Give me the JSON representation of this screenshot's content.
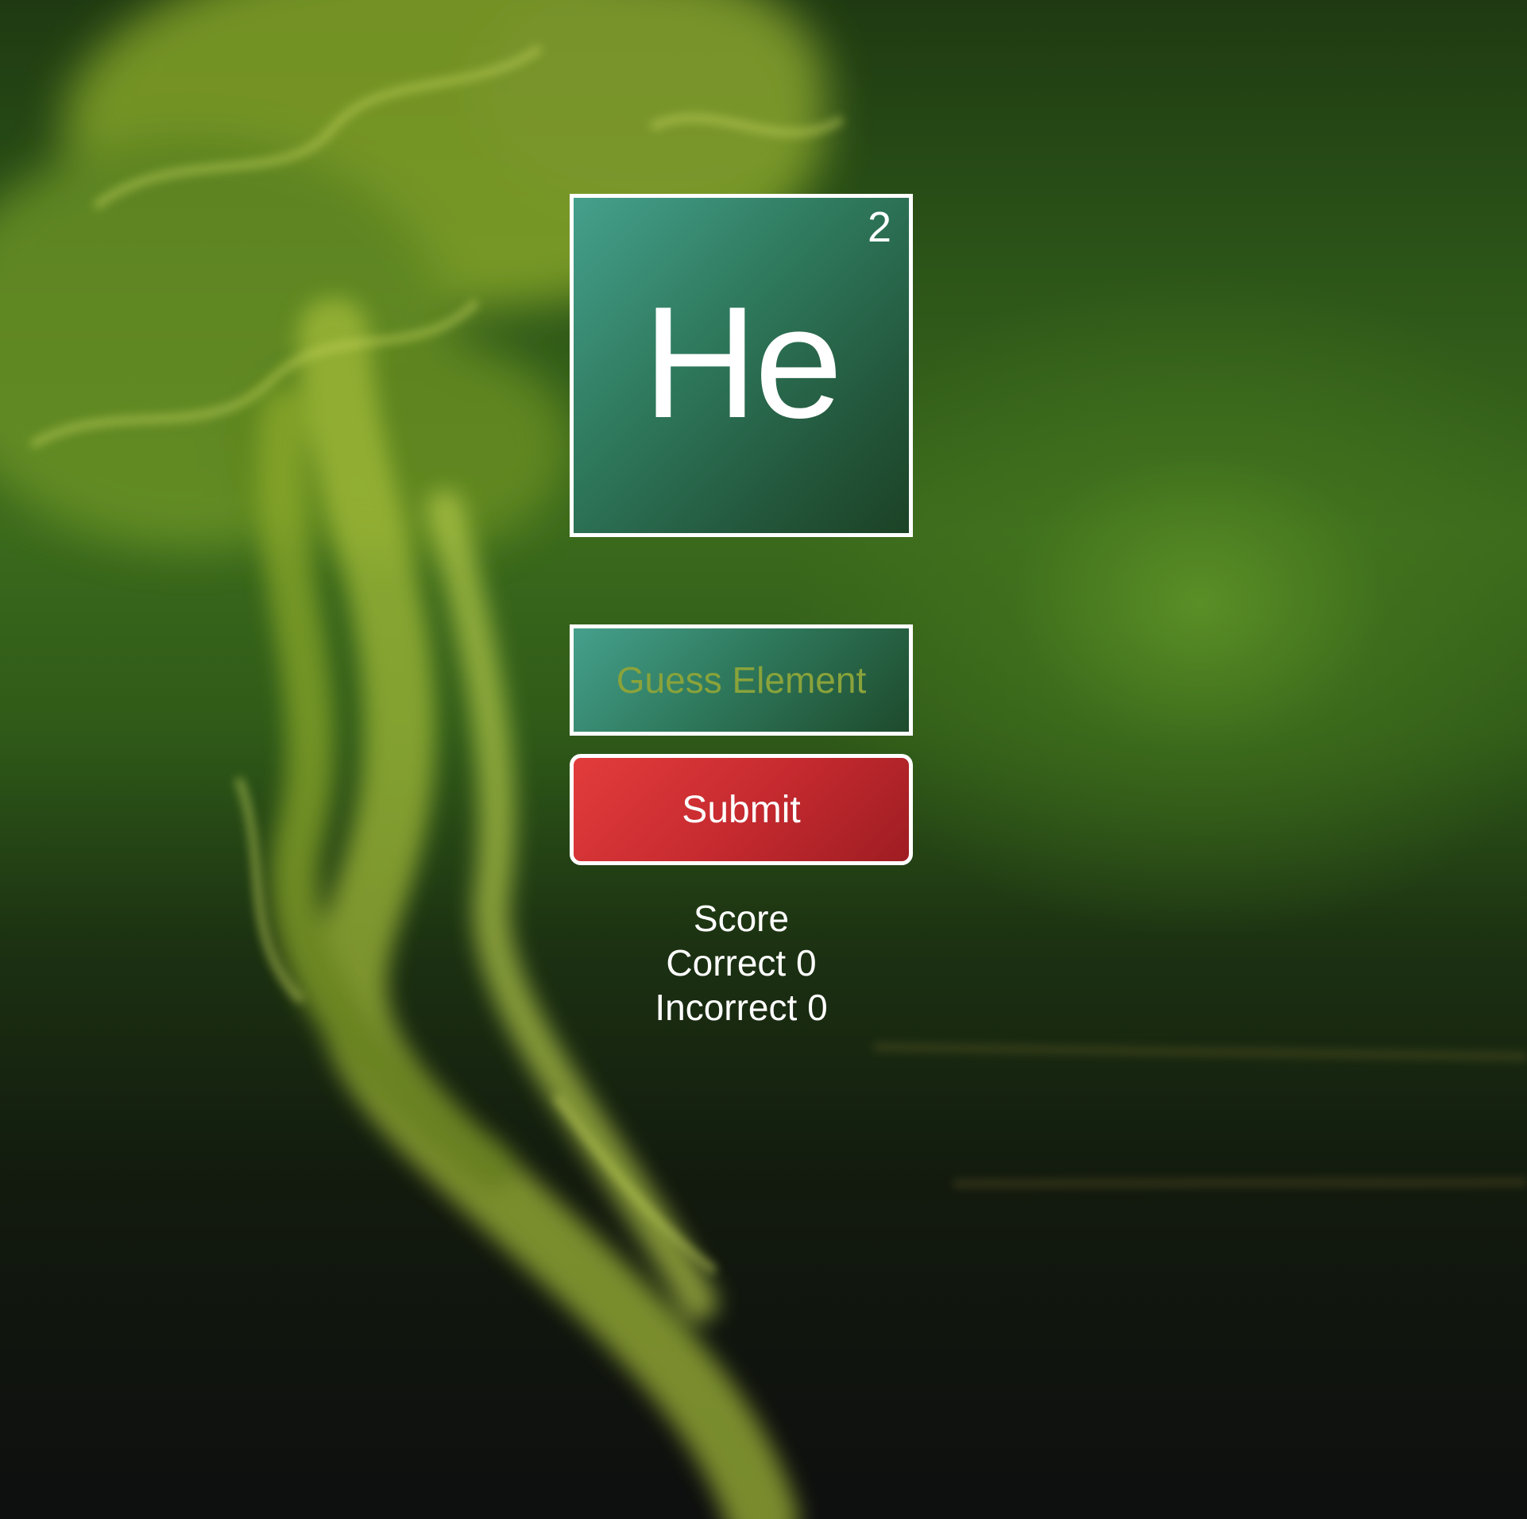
{
  "element": {
    "atomic_number": "2",
    "symbol": "He"
  },
  "guess": {
    "placeholder": "Guess Element",
    "value": ""
  },
  "submit": {
    "label": "Submit"
  },
  "score": {
    "heading": "Score",
    "correct_label": "Correct 0",
    "incorrect_label": "Incorrect 0"
  },
  "colors": {
    "tile_start": "#45a08c",
    "tile_end": "#1c4225",
    "submit_start": "#e33c3c",
    "submit_end": "#9e1d22",
    "placeholder": "#8aa33a",
    "background_smoke": "#9ab52a"
  }
}
